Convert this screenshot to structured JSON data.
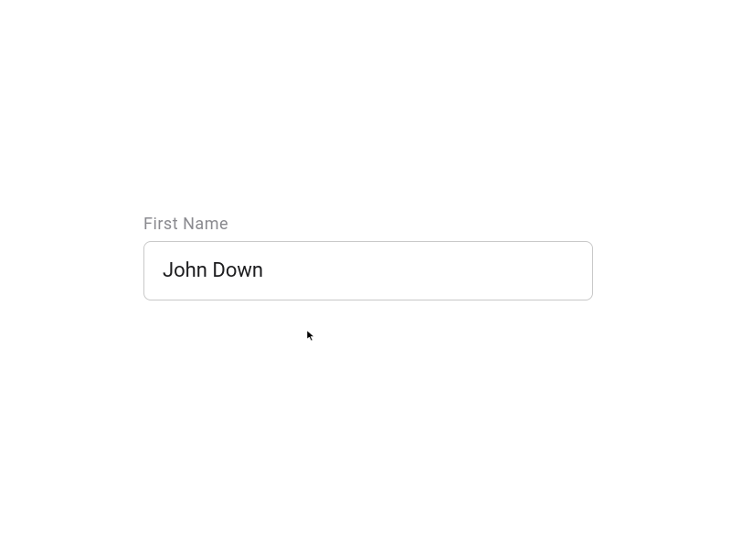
{
  "form": {
    "first_name": {
      "label": "First Name",
      "value": "John Down"
    }
  }
}
